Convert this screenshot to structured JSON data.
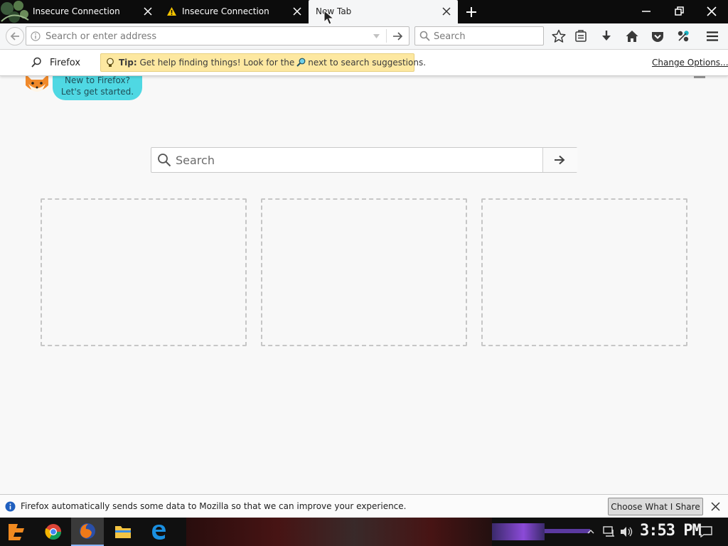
{
  "tabs": [
    {
      "title": "Insecure Connection",
      "warning": false
    },
    {
      "title": "Insecure Connection",
      "warning": true
    },
    {
      "title": "New Tab",
      "active": true
    }
  ],
  "navbar": {
    "url_placeholder": "Search or enter address",
    "search_placeholder": "Search"
  },
  "tipbar": {
    "engine_label": "Firefox",
    "tip_bold": "Tip:",
    "tip_before_icon": " Get help finding things! Look for the",
    "tip_after_icon": "next to search suggestions.",
    "change_options": "Change Options..."
  },
  "onboarding": {
    "text": "New to Firefox?\nLet's get started."
  },
  "content_search": {
    "placeholder": "Search"
  },
  "notification": {
    "text": "Firefox automatically sends some data to Mozilla so that we can improve your experience.",
    "button_label": "Choose What I Share"
  },
  "taskbar": {
    "clock": "3:53 PM"
  },
  "colors": {
    "tab_strip": "#0c0c0c",
    "active_tab": "#f5f6f7",
    "tip_background": "#fde8a1",
    "bubble": "#4fd8e3",
    "page_background": "#f8f8f8"
  },
  "icons": {
    "toolbar": [
      "bookmark-star-icon",
      "reading-list-icon",
      "download-icon",
      "home-icon",
      "pocket-icon",
      "extension-icon",
      "menu-icon"
    ]
  }
}
